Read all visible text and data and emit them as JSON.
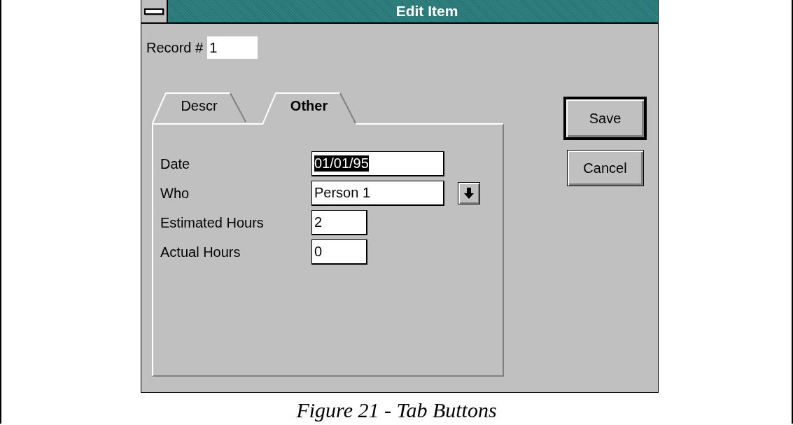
{
  "window": {
    "title": "Edit Item"
  },
  "record": {
    "label": "Record #",
    "value": "1"
  },
  "tabs": [
    {
      "label": "Descr",
      "selected": false
    },
    {
      "label": "Other",
      "selected": true
    }
  ],
  "fields": [
    {
      "label": "Date",
      "value": "01/01/95",
      "kind": "date",
      "highlighted": true
    },
    {
      "label": "Who",
      "value": "Person 1",
      "kind": "dropdown",
      "highlighted": false
    },
    {
      "label": "Estimated Hours",
      "value": "2",
      "kind": "number",
      "highlighted": false
    },
    {
      "label": "Actual Hours",
      "value": "0",
      "kind": "number",
      "highlighted": false
    }
  ],
  "buttons": [
    {
      "label": "Save",
      "default": true
    },
    {
      "label": "Cancel",
      "default": false
    }
  ],
  "caption": "Figure 21 - Tab Buttons"
}
